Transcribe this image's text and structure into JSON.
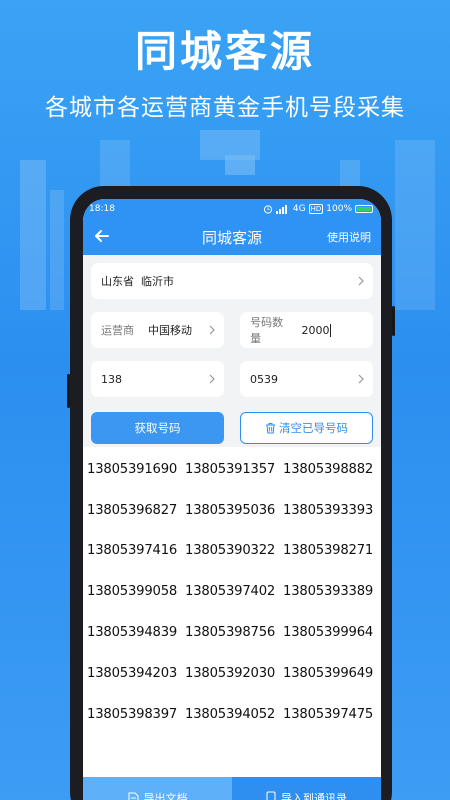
{
  "promo": {
    "title": "同城客源",
    "subtitle": "各城市各运营商黄金手机号段采集"
  },
  "status_bar": {
    "time": "18:18",
    "network": "4G",
    "hd": "HD",
    "battery": "100%"
  },
  "nav": {
    "title": "同城客源",
    "help_label": "使用说明"
  },
  "form": {
    "region": "山东省  临沂市",
    "carrier_label": "运营商",
    "carrier_value": "中国移动",
    "count_label": "号码数量",
    "count_value": "2000",
    "prefix_value": "138",
    "area_code_value": "0539",
    "get_button": "获取号码",
    "clear_button": "清空已导号码"
  },
  "numbers": [
    [
      "13805391690",
      "13805391357",
      "13805398882"
    ],
    [
      "13805396827",
      "13805395036",
      "13805393393"
    ],
    [
      "13805397416",
      "13805390322",
      "13805398271"
    ],
    [
      "13805399058",
      "13805397402",
      "13805393389"
    ],
    [
      "13805394839",
      "13805398756",
      "13805399964"
    ],
    [
      "13805394203",
      "13805392030",
      "13805399649"
    ],
    [
      "13805398397",
      "13805394052",
      "13805397475"
    ]
  ],
  "bottom": {
    "export_doc": "导出文档",
    "import_contacts": "导入到通讯录"
  },
  "colors": {
    "brand": "#2f93f5",
    "background": "#3aa3f5"
  }
}
